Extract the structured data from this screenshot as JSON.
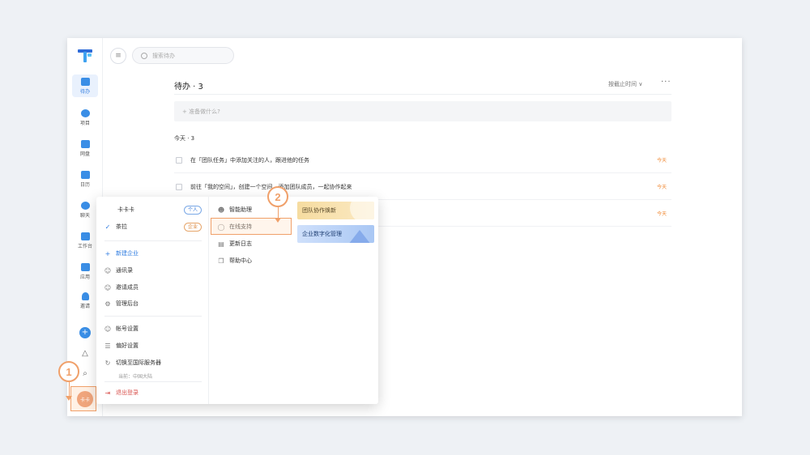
{
  "app": {
    "rail": {
      "items": [
        {
          "label": "待办",
          "icon": "todo-icon",
          "active": true
        },
        {
          "label": "项目",
          "icon": "project-icon"
        },
        {
          "label": "网盘",
          "icon": "folder-icon"
        },
        {
          "label": "日历",
          "icon": "calendar-icon"
        },
        {
          "label": "聊天",
          "icon": "chat-icon"
        },
        {
          "label": "工作台",
          "icon": "workbench-icon"
        },
        {
          "label": "应用",
          "icon": "apps-icon"
        },
        {
          "label": "邀请",
          "icon": "invite-icon"
        }
      ],
      "avatar_text": "卡卡"
    },
    "search": {
      "placeholder": "搜索待办"
    },
    "main": {
      "title": "待办 · 3",
      "sort_label": "按截止时间 ∨",
      "more": "···",
      "add_placeholder": "+ 准备做什么?",
      "group_title": "今天 · 3",
      "tasks": [
        {
          "text": "在「团队任务」中添加关注的人，跟进他的任务",
          "due": "今天"
        },
        {
          "text": "前往「我的空间」，创建一个空间，添加团队成员，一起协作起来",
          "due": "今天"
        },
        {
          "text": "",
          "due": "今天"
        }
      ]
    },
    "popup": {
      "user_name": "卡卡卡",
      "tag_personal": "个人",
      "org_name": "茶拉",
      "tag_enterprise": "企业",
      "new_enterprise": "新建企业",
      "contacts": "通讯录",
      "invite_members": "邀请成员",
      "admin_console": "管理后台",
      "account_settings": "帐号设置",
      "preferences": "偏好设置",
      "switch_region": "切换至国际服务器",
      "current_region": "当前：中国大陆",
      "logout": "退出登录",
      "assistant": "智能助理",
      "online_support": "在线支持",
      "changelog": "更新日志",
      "help_center": "帮助中心",
      "banner1": "团队协作焕新",
      "banner2": "企业数字化管理"
    },
    "callouts": {
      "one": "1",
      "two": "2"
    }
  }
}
